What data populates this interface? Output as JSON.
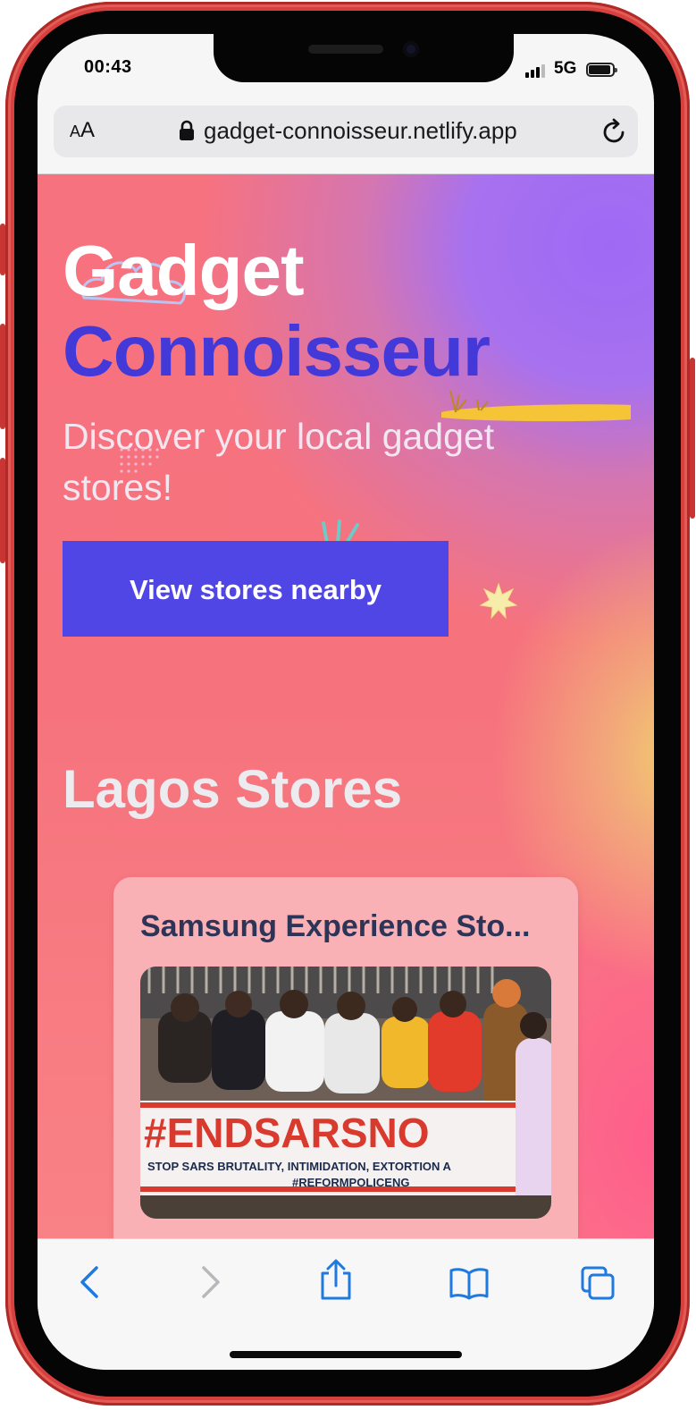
{
  "status_bar": {
    "time": "00:43",
    "network": "5G"
  },
  "browser": {
    "text_size_button": {
      "small": "A",
      "large": "A"
    },
    "url": "gadget-connoisseur.netlify.app",
    "icons": {
      "lock": "lock-icon",
      "reload": "reload-icon"
    }
  },
  "hero": {
    "title_line1": "Gadget",
    "title_line2": "Connoisseur",
    "subtitle": "Discover your local gadget stores!",
    "cta_label": "View stores nearby"
  },
  "stores_section": {
    "heading": "Lagos Stores",
    "stores": [
      {
        "name": "Samsung Experience Sto...",
        "image": {
          "banner_hashtag": "#ENDSARSNO",
          "banner_line": "STOP SARS BRUTALITY, INTIMIDATION, EXTORTION A",
          "banner_tag": "#REFORMPOLICENG"
        }
      }
    ]
  },
  "toolbar": {
    "icons": [
      "back-icon",
      "forward-icon",
      "share-icon",
      "bookmarks-icon",
      "tabs-icon"
    ]
  },
  "colors": {
    "phone_frame": "#d8403f",
    "title_primary": "#ffffff",
    "title_accent": "#4338d8",
    "cta_background": "#4f46e5",
    "card_background": "#f9b1b6",
    "card_title": "#2c3557",
    "ios_blue": "#1f7ae0"
  }
}
